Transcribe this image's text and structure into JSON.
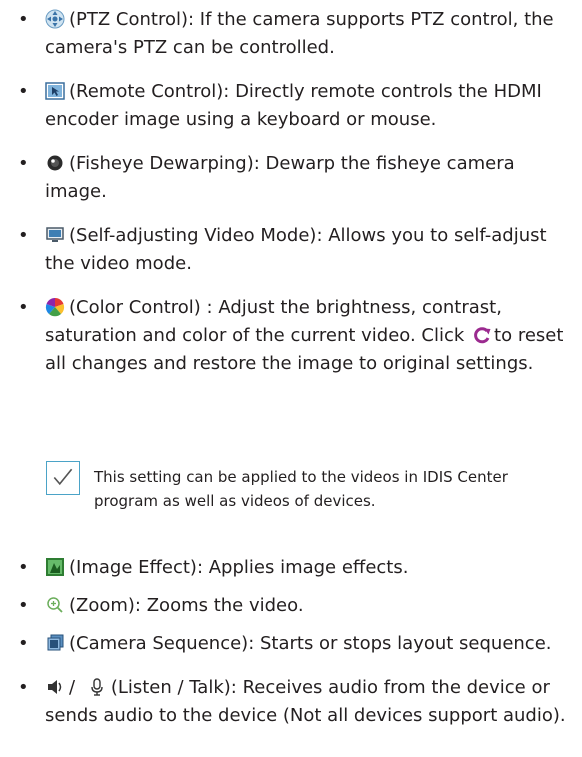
{
  "bullet_char": "•",
  "items": [
    {
      "icon": "ptz-control-icon",
      "text": "(PTZ Control): If the camera supports PTZ control, the camera's PTZ can be controlled."
    },
    {
      "icon": "remote-control-icon",
      "text": "(Remote Control): Directly remote controls the HDMI encoder image using a keyboard or mouse."
    },
    {
      "icon": "fisheye-dewarping-icon",
      "text": "(Fisheye Dewarping): Dewarp the fisheye camera image."
    },
    {
      "icon": "self-adjusting-video-mode-icon",
      "text": "(Self-adjusting Video Mode): Allows you to self-adjust the video mode."
    },
    {
      "icon": "color-control-icon",
      "text_before": "(Color Control) : Adjust the brightness, contrast, saturation and color of the current video. Click",
      "reset_icon": "reset-icon",
      "text_after": "to reset all changes and restore the image to original settings."
    },
    {
      "icon": "image-effect-icon",
      "text": "(Image Effect): Applies image effects."
    },
    {
      "icon": "zoom-icon",
      "text": "(Zoom): Zooms the video."
    },
    {
      "icon": "camera-sequence-icon",
      "text": "(Camera Sequence): Starts or stops layout sequence."
    },
    {
      "icon": "listen-icon",
      "separator": "/",
      "icon2": "talk-icon",
      "text": "(Listen / Talk): Receives audio from the device or sends audio to the device (Not all devices support audio)."
    }
  ],
  "note": {
    "icon": "checkmark-note-icon",
    "text": "This setting can be applied to the videos in IDIS Center program as well as videos of devices."
  },
  "colors": {
    "accent": "#4ba3c7",
    "text": "#231f20",
    "reset": "#9b2a8f"
  }
}
